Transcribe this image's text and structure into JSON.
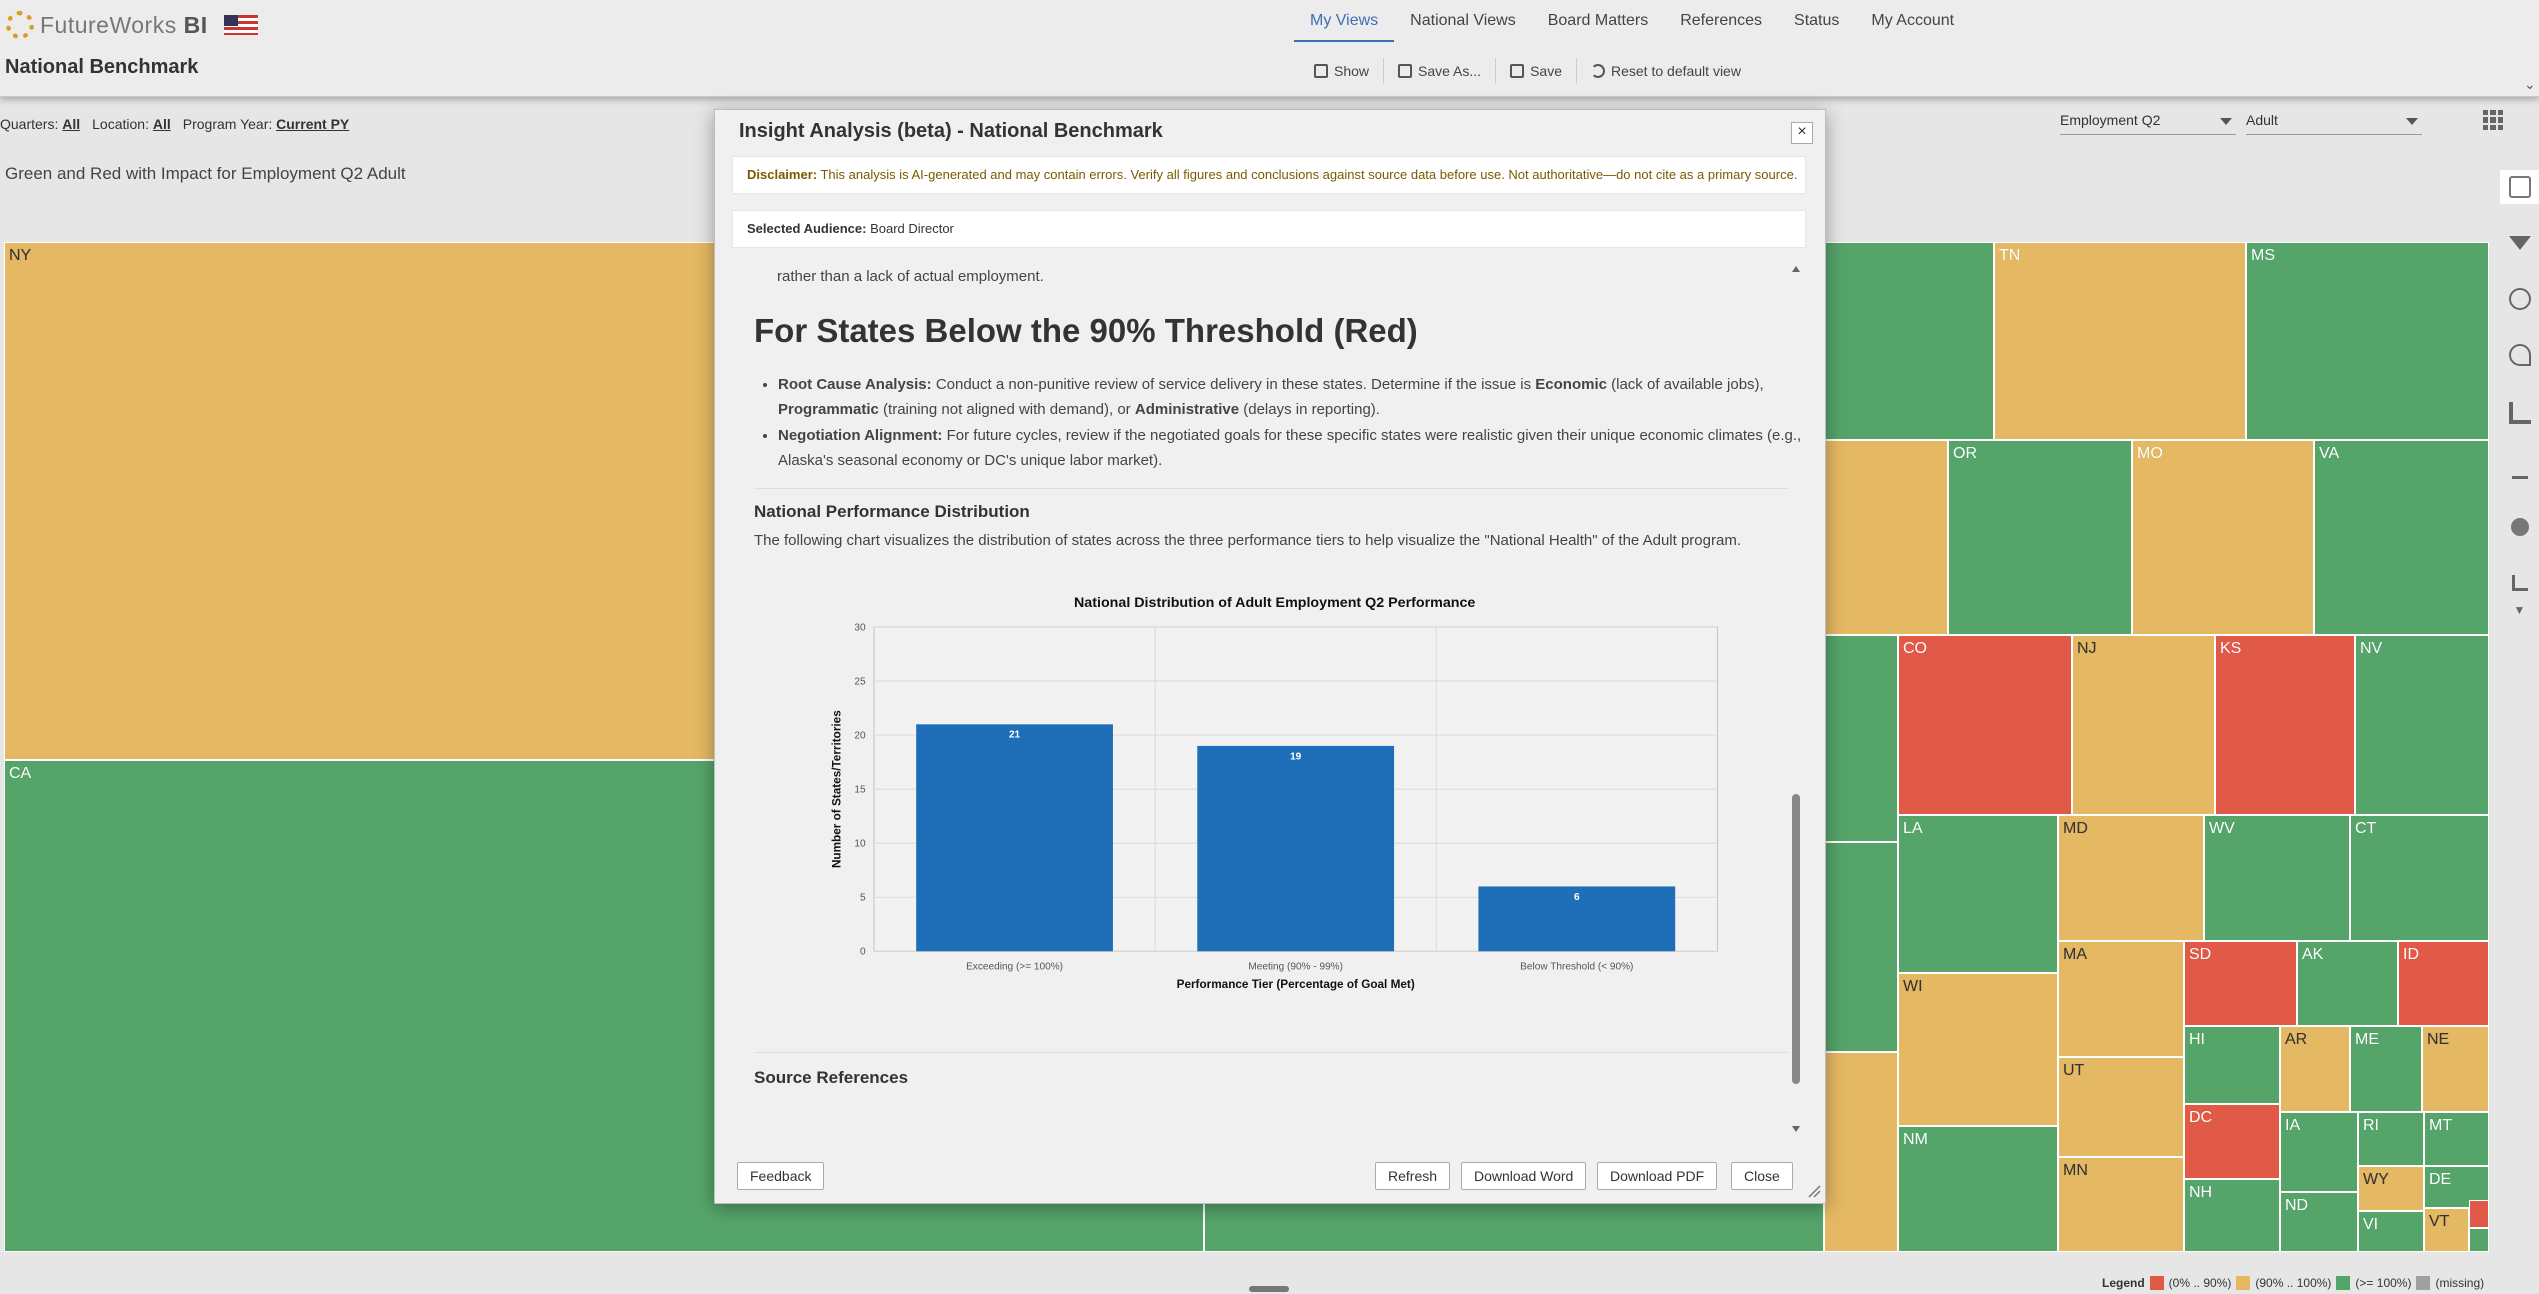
{
  "app": {
    "brand_light": "FutureWorks",
    "brand_bold": "BI"
  },
  "page_title": "National Benchmark",
  "nav": {
    "tabs": [
      {
        "label": "My Views",
        "active": true
      },
      {
        "label": "National Views"
      },
      {
        "label": "Board Matters"
      },
      {
        "label": "References"
      },
      {
        "label": "Status"
      },
      {
        "label": "My Account"
      }
    ]
  },
  "toolbar": {
    "show": "Show",
    "save_as": "Save As...",
    "save": "Save",
    "reset": "Reset to default view"
  },
  "filters": {
    "quarters_label": "Quarters:",
    "quarters_value": "All",
    "location_label": "Location:",
    "location_value": "All",
    "program_year_label": "Program Year:",
    "program_year_value": "Current PY"
  },
  "selects": {
    "measure": "Employment Q2",
    "program": "Adult"
  },
  "view_subtitle": "Green and Red with Impact for Employment Q2 Adult",
  "treemap": {
    "tiles": [
      {
        "label": "NY",
        "status": "y"
      },
      {
        "label": "CA",
        "status": "g"
      },
      {
        "label": "TN",
        "status": "y"
      },
      {
        "label": "MS",
        "status": "g"
      },
      {
        "label": "OR",
        "status": "g"
      },
      {
        "label": "MO",
        "status": "y"
      },
      {
        "label": "VA",
        "status": "g"
      },
      {
        "label": "CO",
        "status": "r"
      },
      {
        "label": "NJ",
        "status": "y"
      },
      {
        "label": "KS",
        "status": "r"
      },
      {
        "label": "NV",
        "status": "g"
      },
      {
        "label": "LA",
        "status": "g"
      },
      {
        "label": "MD",
        "status": "y"
      },
      {
        "label": "WV",
        "status": "g"
      },
      {
        "label": "CT",
        "status": "g"
      },
      {
        "label": "MA",
        "status": "y"
      },
      {
        "label": "SD",
        "status": "r"
      },
      {
        "label": "AK",
        "status": "g"
      },
      {
        "label": "ID",
        "status": "r"
      },
      {
        "label": "WI",
        "status": "y"
      },
      {
        "label": "HI",
        "status": "g"
      },
      {
        "label": "AR",
        "status": "y"
      },
      {
        "label": "ME",
        "status": "g"
      },
      {
        "label": "NE",
        "status": "y"
      },
      {
        "label": "UT",
        "status": "y"
      },
      {
        "label": "DC",
        "status": "r"
      },
      {
        "label": "IA",
        "status": "g"
      },
      {
        "label": "RI",
        "status": "g"
      },
      {
        "label": "MT",
        "status": "g"
      },
      {
        "label": "WY",
        "status": "y"
      },
      {
        "label": "DE",
        "status": "g"
      },
      {
        "label": "NM",
        "status": "g"
      },
      {
        "label": "MN",
        "status": "y"
      },
      {
        "label": "NH",
        "status": "g"
      },
      {
        "label": "ND",
        "status": "g"
      },
      {
        "label": "VI",
        "status": "g"
      },
      {
        "label": "VT",
        "status": "y"
      }
    ]
  },
  "legend": {
    "title": "Legend",
    "items": [
      {
        "label": "(0% .. 90%)",
        "color": "#e05a47"
      },
      {
        "label": "(90% .. 100%)",
        "color": "#e5b963"
      },
      {
        "label": "(>= 100%)",
        "color": "#55a56a"
      },
      {
        "label": "(missing)",
        "color": "#a0a0a0"
      }
    ]
  },
  "modal": {
    "title": "Insight Analysis (beta) - National Benchmark",
    "close_glyph": "×",
    "disclaimer_label": "Disclaimer:",
    "disclaimer_text": "This analysis is AI-generated and may contain errors. Verify all figures and conclusions against source data before use. Not authoritative—do not cite as a primary source.",
    "audience_label": "Selected Audience:",
    "audience_value": "Board Director",
    "content": {
      "carry_text": "rather than a lack of actual employment.",
      "heading": "For States Below the 90% Threshold (Red)",
      "bullets": [
        {
          "bold": "Root Cause Analysis:",
          "t1": " Conduct a non-punitive review of service delivery in these states. Determine if the issue is ",
          "b2": "Economic",
          "t2": " (lack of available jobs), ",
          "b3": "Programmatic",
          "t3": " (training not aligned with demand), or ",
          "b4": "Administrative",
          "t4": " (delays in reporting)."
        },
        {
          "bold": "Negotiation Alignment:",
          "t1": " For future cycles, review if the negotiated goals for these specific states were realistic given their unique economic climates (e.g., Alaska's seasonal economy or DC's unique labor market)."
        }
      ],
      "section_heading": "National Performance Distribution",
      "section_intro": "The following chart visualizes the distribution of states across the three performance tiers to help visualize the \"National Health\" of the Adult program.",
      "source_heading": "Source References"
    },
    "footer": {
      "feedback": "Feedback",
      "refresh": "Refresh",
      "download_word": "Download Word",
      "download_pdf": "Download PDF",
      "close": "Close"
    }
  },
  "chart_data": {
    "type": "bar",
    "title": "National Distribution of Adult Employment Q2 Performance",
    "categories": [
      "Exceeding (>= 100%)",
      "Meeting (90% - 99%)",
      "Below Threshold (< 90%)"
    ],
    "values": [
      21,
      19,
      6
    ],
    "data_labels": [
      "21",
      "19",
      "6"
    ],
    "xlabel": "Performance Tier (Percentage of Goal Met)",
    "ylabel": "Number of States/Territories",
    "ylim": [
      0,
      30
    ],
    "yticks": [
      0,
      5,
      10,
      15,
      20,
      25,
      30
    ],
    "grid": true,
    "bar_color": "#1f6fb8"
  }
}
